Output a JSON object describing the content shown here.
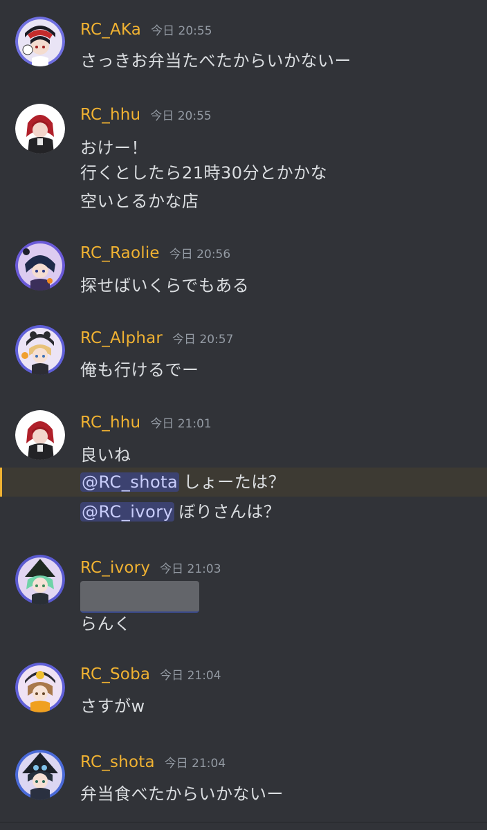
{
  "messages": [
    {
      "username": "RC_AKa",
      "timestamp": "今日 20:55",
      "avatar_color": "#d8c7e8",
      "lines": [
        "さっきお弁当たべたからいかないー"
      ]
    },
    {
      "username": "RC_hhu",
      "timestamp": "今日 20:55",
      "avatar_color": "#ffffff",
      "lines": [
        "おけー！",
        "行くとしたら21時30分とかかな",
        "空いとるかな店"
      ]
    },
    {
      "username": "RC_Raolie",
      "timestamp": "今日 20:56",
      "avatar_color": "#c9b6e8",
      "lines": [
        "探せばいくらでもある"
      ]
    },
    {
      "username": "RC_Alphar",
      "timestamp": "今日 20:57",
      "avatar_color": "#e6ddf0",
      "lines": [
        "俺も行けるでー"
      ]
    },
    {
      "username": "RC_hhu",
      "timestamp": "今日 21:01",
      "avatar_color": "#ffffff",
      "lines": [
        "良いね"
      ],
      "mention_lines": [
        {
          "mention": "@RC_shota",
          "text": "しょーたは？",
          "highlighted": true
        },
        {
          "mention": "@RC_ivory",
          "text": "ぼりさんは？",
          "highlighted": false
        }
      ]
    },
    {
      "username": "RC_ivory",
      "timestamp": "今日 21:03",
      "avatar_color": "#dcd0f0",
      "lines": [
        "らんく"
      ]
    },
    {
      "username": "RC_Soba",
      "timestamp": "今日 21:04",
      "avatar_color": "#e8d8f2",
      "lines": [
        "さすがw"
      ]
    },
    {
      "username": "RC_shota",
      "timestamp": "今日 21:04",
      "avatar_color": "#d6d2f0",
      "lines": [
        "弁当食べたからいかないー"
      ]
    }
  ],
  "colors": {
    "background": "#313338",
    "username": "#f0b232",
    "timestamp": "#949ba4",
    "text": "#dbdee1",
    "mention_bg": "#3c4270",
    "mention_text": "#c9cdfb",
    "highlight_bg": "#3d3a33",
    "highlight_bar": "#f0b232"
  }
}
